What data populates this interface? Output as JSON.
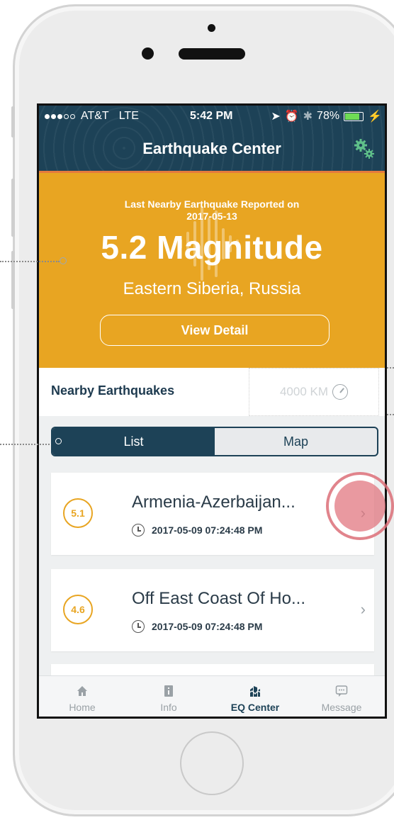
{
  "status_bar": {
    "carrier": "AT&T",
    "network": "LTE",
    "time": "5:42 PM",
    "battery": "78%",
    "battery_fill": 0.78
  },
  "header": {
    "title": "Earthquake Center",
    "settings_icon": "gear-icon"
  },
  "banner": {
    "reported_line1": "Last Nearby Earthquake Reported on",
    "reported_date": "2017-05-13",
    "magnitude": "5.2 Magnitude",
    "location": "Eastern Siberia, Russia",
    "detail_button": "View Detail"
  },
  "nearby": {
    "label": "Nearby Earthquakes",
    "distance": "4000 KM",
    "distance_icon": "radar-icon"
  },
  "segmented": {
    "list": "List",
    "map": "Map",
    "active": "list"
  },
  "quakes": [
    {
      "magnitude": "5.1",
      "place": "Armenia-Azerbaijan...",
      "time": "2017-05-09 07:24:48 PM"
    },
    {
      "magnitude": "4.6",
      "place": "Off East Coast Of Ho...",
      "time": "2017-05-09 07:24:48 PM"
    }
  ],
  "tabbar": [
    {
      "label": "Home",
      "icon": "home-icon"
    },
    {
      "label": "Info",
      "icon": "info-icon"
    },
    {
      "label": "EQ Center",
      "icon": "eq-center-icon",
      "active": true
    },
    {
      "label": "Message",
      "icon": "message-icon"
    }
  ],
  "colors": {
    "header": "#1d4257",
    "banner": "#e8a522",
    "accent_line": "#e57a3d",
    "battery": "#6fdc55"
  }
}
